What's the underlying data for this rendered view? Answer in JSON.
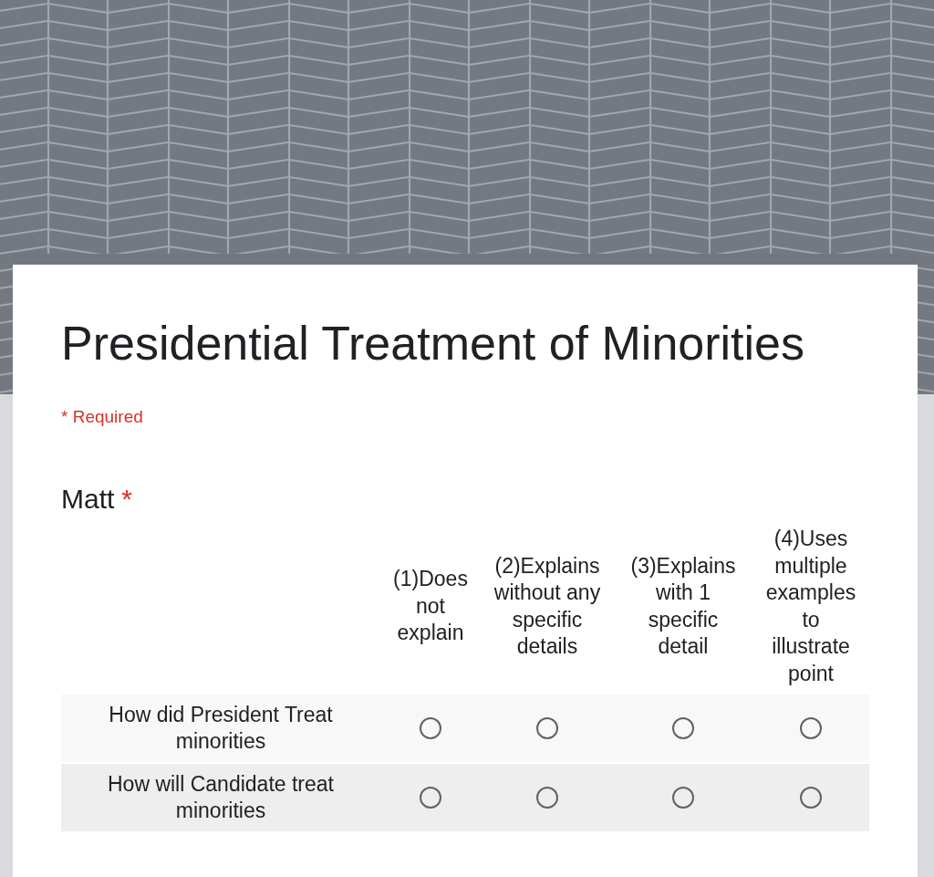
{
  "form": {
    "title": "Presidential Treatment of Minorities",
    "required_note": "* Required"
  },
  "question": {
    "title": "Matt",
    "required_mark": "*",
    "required": true,
    "columns": [
      "(1)Does not explain",
      "(2)Explains without any specific details",
      "(3)Explains with 1 specific detail",
      "(4)Uses multiple examples to illustrate point"
    ],
    "rows": [
      {
        "label": "How did President Treat minorities",
        "choices": [
          {
            "selected": false
          },
          {
            "selected": false
          },
          {
            "selected": false
          },
          {
            "selected": false
          }
        ]
      },
      {
        "label": "How will Candidate treat minorities",
        "choices": [
          {
            "selected": false
          },
          {
            "selected": false
          },
          {
            "selected": false
          },
          {
            "selected": false
          }
        ]
      }
    ]
  }
}
